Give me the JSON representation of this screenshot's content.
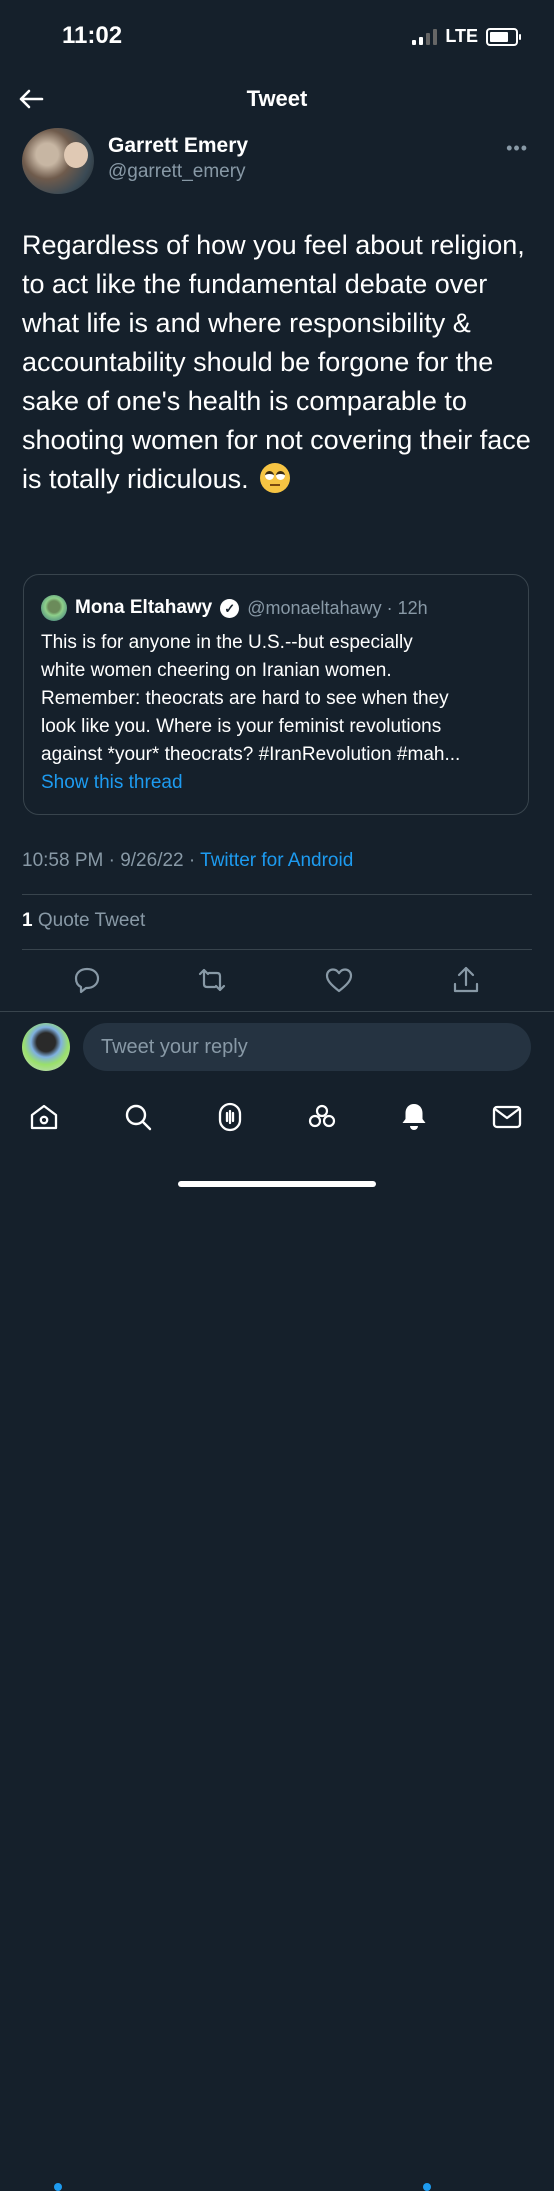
{
  "status": {
    "time": "11:02",
    "network": "LTE"
  },
  "nav": {
    "title": "Tweet"
  },
  "author": {
    "name": "Garrett Emery",
    "handle": "@garrett_emery"
  },
  "tweet": {
    "text": "Regardless of how you feel about religion, to act like the fundamental debate over what life is and where responsibility & accountability should be forgone for the sake of one's health is comparable to shooting women for not covering their face is totally ridiculous.",
    "emoji": "face-with-rolling-eyes"
  },
  "quote": {
    "name": "Mona Eltahawy",
    "handle_time": "@monaeltahawy · 12h",
    "lines": [
      "This is for anyone in the U.S.--but especially",
      "white women cheering on Iranian women.",
      "Remember: theocrats are hard to see when they",
      "look like you. Where is your feminist revolutions",
      "against *your* theocrats? #IranRevolution #mah..."
    ],
    "show_thread": "Show this thread"
  },
  "meta": {
    "timestamp": "10:58 PM · 9/26/22 · ",
    "source": "Twitter for Android"
  },
  "stats": {
    "quote_count": "1",
    "quote_label": " Quote Tweet"
  },
  "reply": {
    "placeholder": "Tweet your reply"
  },
  "icons": {
    "actions": [
      "reply-icon",
      "retweet-icon",
      "like-icon",
      "share-icon"
    ],
    "tabs": [
      "home-icon",
      "search-icon",
      "spaces-icon",
      "communities-icon",
      "notifications-icon",
      "messages-icon"
    ]
  },
  "colors": {
    "background": "#15202b",
    "accent": "#1d9bf0",
    "secondary_text": "#8899a6",
    "border": "#38444d"
  }
}
